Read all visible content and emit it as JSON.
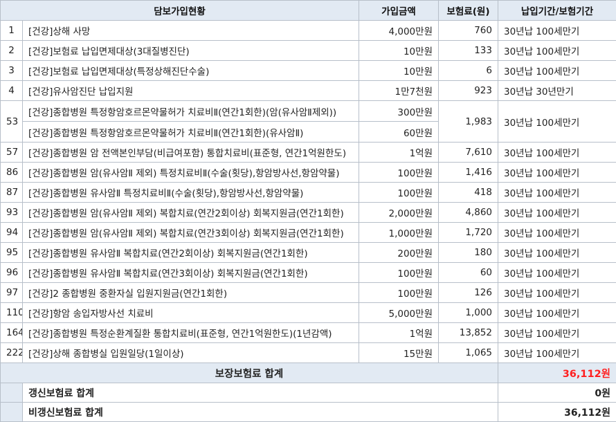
{
  "header": {
    "title": "담보가입현황",
    "amount": "가입금액",
    "premium": "보험료(원)",
    "period": "납입기간/보험기간"
  },
  "rows": [
    {
      "no": "1",
      "name": "[건강]상해 사망",
      "amount": "4,000만원",
      "premium": "760",
      "period": "30년납 100세만기"
    },
    {
      "no": "2",
      "name": "[건강]보험료 납입면제대상(3대질병진단)",
      "amount": "10만원",
      "premium": "133",
      "period": "30년납 100세만기"
    },
    {
      "no": "3",
      "name": "[건강]보험료 납입면제대상(특정상해진단수술)",
      "amount": "10만원",
      "premium": "6",
      "period": "30년납 100세만기"
    },
    {
      "no": "4",
      "name": "[건강]유사암진단 납입지원",
      "amount": "1만7천원",
      "premium": "923",
      "period": "30년납 30년만기"
    },
    {
      "no": "53",
      "name": "[건강]종합병원 특정항암호르몬약물허가 치료비Ⅱ(연간1회한)(암(유사암Ⅱ제외))",
      "amount": "300만원",
      "premium": "1,983",
      "period": "30년납 100세만기",
      "sub": {
        "name": "[건강]종합병원 특정항암호르몬약물허가 치료비Ⅱ(연간1회한)(유사암Ⅱ)",
        "amount": "60만원"
      }
    },
    {
      "no": "57",
      "name": "[건강]종합병원 암 전액본인부담(비급여포함) 통합치료비(표준형, 연간1억원한도)",
      "amount": "1억원",
      "premium": "7,610",
      "period": "30년납 100세만기"
    },
    {
      "no": "86",
      "name": "[건강]종합병원 암(유사암Ⅱ 제외) 특정치료비Ⅱ(수술(횟당),항암방사선,항암약물)",
      "amount": "100만원",
      "premium": "1,416",
      "period": "30년납 100세만기"
    },
    {
      "no": "87",
      "name": "[건강]종합병원 유사암Ⅱ 특정치료비Ⅱ(수술(횟당),항암방사선,항암약물)",
      "amount": "100만원",
      "premium": "418",
      "period": "30년납 100세만기"
    },
    {
      "no": "93",
      "name": "[건강]종합병원 암(유사암Ⅱ 제외) 복합치료(연간2회이상) 회복지원금(연간1회한)",
      "amount": "2,000만원",
      "premium": "4,860",
      "period": "30년납 100세만기"
    },
    {
      "no": "94",
      "name": "[건강]종합병원 암(유사암Ⅱ 제외) 복합치료(연간3회이상) 회복지원금(연간1회한)",
      "amount": "1,000만원",
      "premium": "1,720",
      "period": "30년납 100세만기"
    },
    {
      "no": "95",
      "name": "[건강]종합병원 유사암Ⅱ 복합치료(연간2회이상) 회복지원금(연간1회한)",
      "amount": "200만원",
      "premium": "180",
      "period": "30년납 100세만기"
    },
    {
      "no": "96",
      "name": "[건강]종합병원 유사암Ⅱ 복합치료(연간3회이상) 회복지원금(연간1회한)",
      "amount": "100만원",
      "premium": "60",
      "period": "30년납 100세만기"
    },
    {
      "no": "97",
      "name": "[건강]2 종합병원 중환자실 입원지원금(연간1회한)",
      "amount": "100만원",
      "premium": "126",
      "period": "30년납 100세만기"
    },
    {
      "no": "110",
      "name": "[건강]항암 송입자방사선 치료비",
      "amount": "5,000만원",
      "premium": "1,000",
      "period": "30년납 100세만기"
    },
    {
      "no": "164",
      "name": "[건강]종합병원 특정순환계질환 통합치료비(표준형, 연간1억원한도)(1년감액)",
      "amount": "1억원",
      "premium": "13,852",
      "period": "30년납 100세만기"
    },
    {
      "no": "222",
      "name": "[건강]상해 종합병실 입원일당(1일이상)",
      "amount": "15만원",
      "premium": "1,065",
      "period": "30년납 100세만기"
    }
  ],
  "totals": {
    "label": "보장보험료 합계",
    "value": "36,112원",
    "value_color": "#ff1f1f",
    "renewal_label": "갱신보험료 합계",
    "renewal_value": "0원",
    "nonrenewal_label": "비갱신보험료 합계",
    "nonrenewal_value": "36,112원"
  }
}
